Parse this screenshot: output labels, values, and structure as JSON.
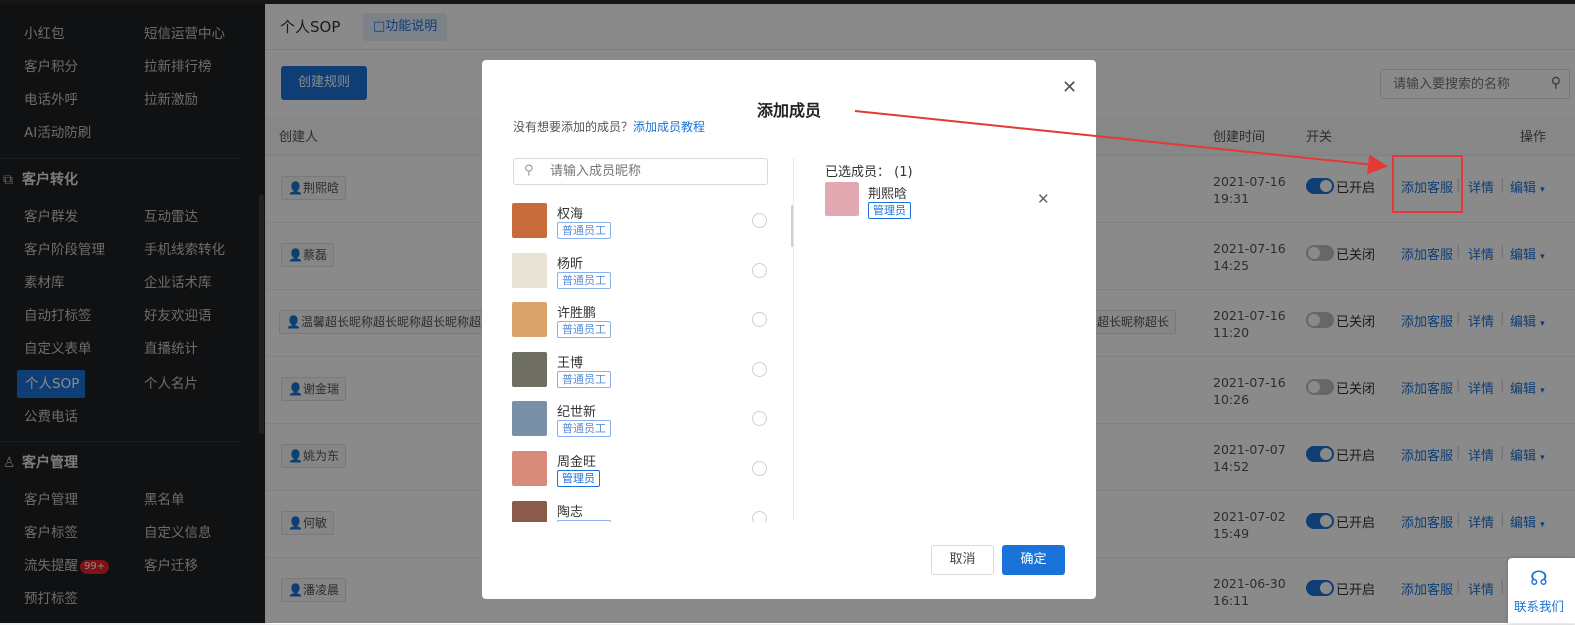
{
  "sidebar": {
    "rows": [
      {
        "c1": "小红包",
        "c2": "短信运营中心"
      },
      {
        "c1": "客户积分",
        "c2": "拉新排行榜"
      },
      {
        "c1": "电话外呼",
        "c2": "拉新激励"
      },
      {
        "c1": "AI活动防刷",
        "c2": ""
      }
    ],
    "section_conversion": {
      "title": "客户转化",
      "rows": [
        {
          "c1": "客户群发",
          "c2": "互动雷达"
        },
        {
          "c1": "客户阶段管理",
          "c2": "手机线索转化"
        },
        {
          "c1": "素材库",
          "c2": "企业话术库"
        },
        {
          "c1": "自动打标签",
          "c2": "好友欢迎语"
        },
        {
          "c1": "自定义表单",
          "c2": "直播统计"
        },
        {
          "c1": "个人SOP",
          "c2": "个人名片"
        },
        {
          "c1": "公费电话",
          "c2": ""
        }
      ]
    },
    "section_manage": {
      "title": "客户管理",
      "rows": [
        {
          "c1": "客户管理",
          "c2": "黑名单"
        },
        {
          "c1": "客户标签",
          "c2": "自定义信息"
        },
        {
          "c1": "流失提醒",
          "c1_badge": "99+",
          "c2": "客户迁移"
        },
        {
          "c1": "预打标签",
          "c2": ""
        }
      ]
    }
  },
  "header": {
    "title": "个人SOP",
    "func_link": "功能说明"
  },
  "toolbar": {
    "create_label": "创建规则",
    "search_placeholder": "请输入要搜索的名称"
  },
  "table": {
    "headers": {
      "creator": "创建人",
      "created": "创建时间",
      "switch": "开关",
      "ops": "操作"
    },
    "rows": [
      {
        "creator": "荆熙晗",
        "extra": "",
        "date": "2021-07-16",
        "time": "19:31",
        "on": true,
        "switch_label": "已开启"
      },
      {
        "creator": "蔡磊",
        "extra": "",
        "date": "2021-07-16",
        "time": "14:25",
        "on": false,
        "switch_label": "已关闭"
      },
      {
        "creator": "温馨超长昵称超长昵称超长昵称超",
        "extra": "超长昵称超长",
        "date": "2021-07-16",
        "time": "11:20",
        "on": false,
        "switch_label": "已关闭"
      },
      {
        "creator": "谢金瑞",
        "extra": "",
        "date": "2021-07-16",
        "time": "10:26",
        "on": false,
        "switch_label": "已关闭"
      },
      {
        "creator": "姚为东",
        "extra": "",
        "date": "2021-07-07",
        "time": "14:52",
        "on": true,
        "switch_label": "已开启"
      },
      {
        "creator": "何敏",
        "extra": "",
        "date": "2021-07-02",
        "time": "15:49",
        "on": true,
        "switch_label": "已开启"
      },
      {
        "creator": "潘凌晨",
        "extra": "",
        "date": "2021-06-30",
        "time": "16:11",
        "on": true,
        "switch_label": "已开启"
      }
    ],
    "ops": {
      "add": "添加客服",
      "detail": "详情",
      "edit": "编辑"
    }
  },
  "modal": {
    "title": "添加成员",
    "hint": "没有想要添加的成员？",
    "hint_link": "添加成员教程",
    "search_placeholder": "请输入成员昵称",
    "members": [
      {
        "name": "权海",
        "role": "普通员工",
        "admin": false,
        "color": "#c86b3a"
      },
      {
        "name": "杨昕",
        "role": "普通员工",
        "admin": false,
        "color": "#e9e3d6"
      },
      {
        "name": "许胜鹏",
        "role": "普通员工",
        "admin": false,
        "color": "#d9a46a"
      },
      {
        "name": "王博",
        "role": "普通员工",
        "admin": false,
        "color": "#6e6e63"
      },
      {
        "name": "纪世新",
        "role": "普通员工",
        "admin": false,
        "color": "#7a8fa8"
      },
      {
        "name": "周金旺",
        "role": "管理员",
        "admin": true,
        "color": "#d98b7a"
      },
      {
        "name": "陶志",
        "role": "普通员工",
        "admin": false,
        "color": "#8a5a4a"
      }
    ],
    "selected_label": "已选成员：",
    "selected_count": "(1)",
    "selected": {
      "name": "荆熙晗",
      "role": "管理员",
      "color": "#e3a9b3"
    },
    "cancel": "取消",
    "ok": "确定"
  },
  "contact": {
    "label": "联系我们"
  }
}
